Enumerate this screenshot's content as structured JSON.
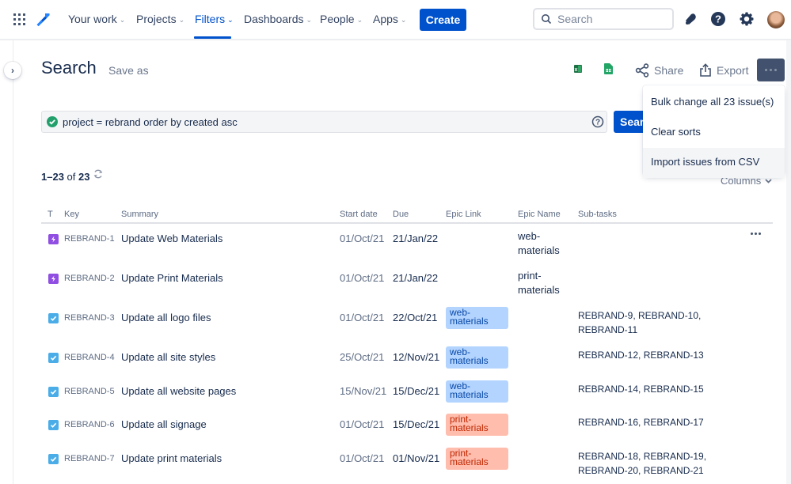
{
  "nav": {
    "items": [
      {
        "label": "Your work",
        "active": false
      },
      {
        "label": "Projects",
        "active": false
      },
      {
        "label": "Filters",
        "active": true
      },
      {
        "label": "Dashboards",
        "active": false
      },
      {
        "label": "People",
        "active": false
      },
      {
        "label": "Apps",
        "active": false
      }
    ],
    "create_label": "Create",
    "search_placeholder": "Search",
    "accent": "#0052cc"
  },
  "header": {
    "title": "Search",
    "save_as": "Save as",
    "share_label": "Share",
    "export_label": "Export"
  },
  "jql": {
    "query": "project = rebrand order by created asc",
    "search_button": "Search"
  },
  "more_menu": {
    "items": [
      {
        "label": "Bulk change all 23 issue(s)"
      },
      {
        "label": "Clear sorts"
      },
      {
        "label": "Import issues from CSV"
      }
    ]
  },
  "results": {
    "range": "1–23",
    "of": "of",
    "total": "23",
    "columns_label": "Columns"
  },
  "table": {
    "headers": [
      "T",
      "Key",
      "Summary",
      "Start date",
      "Due",
      "Epic Link",
      "Epic Name",
      "Sub-tasks"
    ],
    "rows": [
      {
        "type": "epic",
        "key": "REBRAND-1",
        "summary": "Update Web Materials",
        "start": "01/Oct/21",
        "due": "21/Jan/22",
        "epic_link": "",
        "epic_link_kind": "",
        "epic_name": "web-\nmaterials",
        "subtasks": ""
      },
      {
        "type": "epic",
        "key": "REBRAND-2",
        "summary": "Update Print Materials",
        "start": "01/Oct/21",
        "due": "21/Jan/22",
        "epic_link": "",
        "epic_link_kind": "",
        "epic_name": "print-\nmaterials",
        "subtasks": ""
      },
      {
        "type": "task",
        "key": "REBRAND-3",
        "summary": "Update all logo files",
        "start": "01/Oct/21",
        "due": "22/Oct/21",
        "epic_link": "web-materials",
        "epic_link_kind": "web",
        "epic_name": "",
        "subtasks": "REBRAND-9, REBRAND-10, REBRAND-11"
      },
      {
        "type": "task",
        "key": "REBRAND-4",
        "summary": "Update all site styles",
        "start": "25/Oct/21",
        "due": "12/Nov/21",
        "epic_link": "web-materials",
        "epic_link_kind": "web",
        "epic_name": "",
        "subtasks": "REBRAND-12, REBRAND-13"
      },
      {
        "type": "task",
        "key": "REBRAND-5",
        "summary": "Update all website pages",
        "start": "15/Nov/21",
        "due": "15/Dec/21",
        "epic_link": "web-materials",
        "epic_link_kind": "web",
        "epic_name": "",
        "subtasks": "REBRAND-14, REBRAND-15"
      },
      {
        "type": "task",
        "key": "REBRAND-6",
        "summary": "Update all signage",
        "start": "01/Oct/21",
        "due": "15/Dec/21",
        "epic_link": "print-materials",
        "epic_link_kind": "print",
        "epic_name": "",
        "subtasks": "REBRAND-16, REBRAND-17"
      },
      {
        "type": "task",
        "key": "REBRAND-7",
        "summary": "Update print materials",
        "start": "01/Oct/21",
        "due": "01/Nov/21",
        "epic_link": "print-materials",
        "epic_link_kind": "print",
        "epic_name": "",
        "subtasks": "REBRAND-18, REBRAND-19, REBRAND-20, REBRAND-21"
      }
    ]
  }
}
